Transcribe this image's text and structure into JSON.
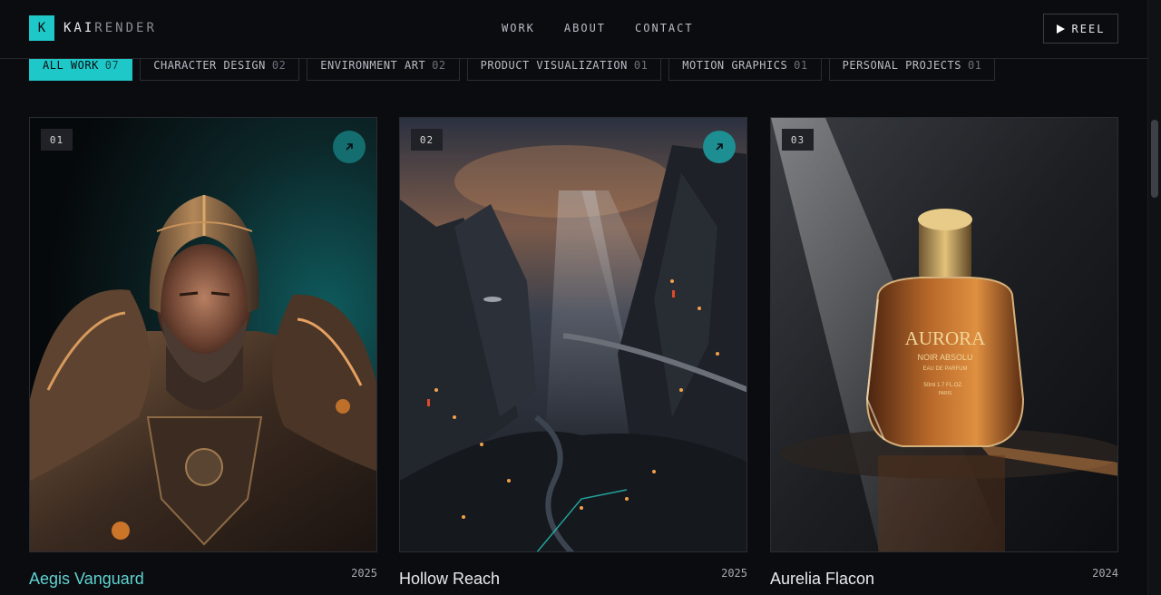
{
  "header": {
    "logo_mark": "K",
    "logo_text_a": "KAI",
    "logo_text_b": "RENDER",
    "nav": [
      "WORK",
      "ABOUT",
      "CONTACT"
    ],
    "reel_label": "REEL"
  },
  "filters": [
    {
      "label": "ALL WORK",
      "count": "07",
      "active": true
    },
    {
      "label": "CHARACTER DESIGN",
      "count": "02",
      "active": false
    },
    {
      "label": "ENVIRONMENT ART",
      "count": "02",
      "active": false
    },
    {
      "label": "PRODUCT VISUALIZATION",
      "count": "01",
      "active": false
    },
    {
      "label": "MOTION GRAPHICS",
      "count": "01",
      "active": false
    },
    {
      "label": "PERSONAL PROJECTS",
      "count": "01",
      "active": false
    }
  ],
  "projects": [
    {
      "number": "01",
      "title": "Aegis Vanguard",
      "year": "2025",
      "highlight": true,
      "has_link": true
    },
    {
      "number": "02",
      "title": "Hollow Reach",
      "year": "2025",
      "highlight": false,
      "has_link": true
    },
    {
      "number": "03",
      "title": "Aurelia Flacon",
      "year": "2024",
      "highlight": false,
      "has_link": false,
      "label_brand": "AURORA",
      "label_sub": "NOIR ABSOLU",
      "label_type": "EAU DE PARFUM",
      "label_volume": "50ml 1.7 FL.OZ.",
      "label_city": "PARIS"
    }
  ],
  "colors": {
    "accent": "#1fc8c8",
    "background": "#0b0c10",
    "arrow_button": "#146e70"
  },
  "icons": {
    "reel": "play-icon",
    "card_link": "arrow-up-right-icon"
  }
}
